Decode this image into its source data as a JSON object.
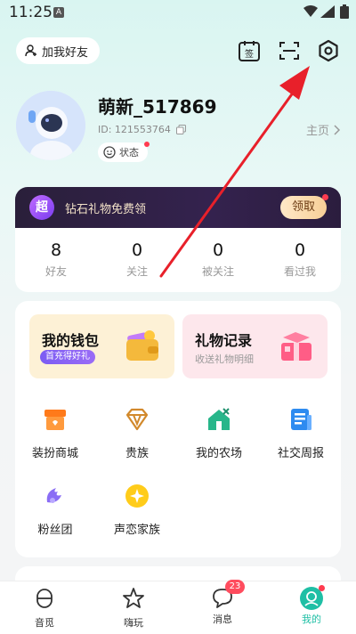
{
  "status_bar": {
    "time": "11:25",
    "notif_icon": "A"
  },
  "header": {
    "add_friend_label": "加我好友",
    "icons": [
      "calendar-sign-icon",
      "scan-icon",
      "settings-icon"
    ]
  },
  "profile": {
    "username": "萌新_517869",
    "id_text": "ID: 121553764",
    "status_label": "状态",
    "homepage_label": "主页"
  },
  "vip": {
    "badge": "超",
    "text": "钻石礼物免费领",
    "claim_label": "领取"
  },
  "stats": [
    {
      "num": "8",
      "label": "好友"
    },
    {
      "num": "0",
      "label": "关注"
    },
    {
      "num": "0",
      "label": "被关注"
    },
    {
      "num": "0",
      "label": "看过我"
    }
  ],
  "cards": {
    "wallet": {
      "title": "我的钱包",
      "sub": "首充得好礼"
    },
    "gift": {
      "title": "礼物记录",
      "sub": "收送礼物明细"
    }
  },
  "grid": [
    {
      "label": "装扮商城",
      "icon": "shop-icon"
    },
    {
      "label": "贵族",
      "icon": "diamond-icon"
    },
    {
      "label": "我的农场",
      "icon": "farm-icon"
    },
    {
      "label": "社交周报",
      "icon": "report-icon"
    },
    {
      "label": "粉丝团",
      "icon": "fan-icon"
    },
    {
      "label": "声恋家族",
      "icon": "star-icon"
    }
  ],
  "tabbar": [
    {
      "label": "音觅",
      "icon": "voice-icon"
    },
    {
      "label": "嗨玩",
      "icon": "star-outline-icon"
    },
    {
      "label": "消息",
      "icon": "message-icon",
      "badge": "23"
    },
    {
      "label": "我的",
      "icon": "profile-icon"
    }
  ],
  "colors": {
    "accent": "#1fbfa5",
    "badge": "#ff4c5e",
    "arrow": "#e8202a"
  }
}
